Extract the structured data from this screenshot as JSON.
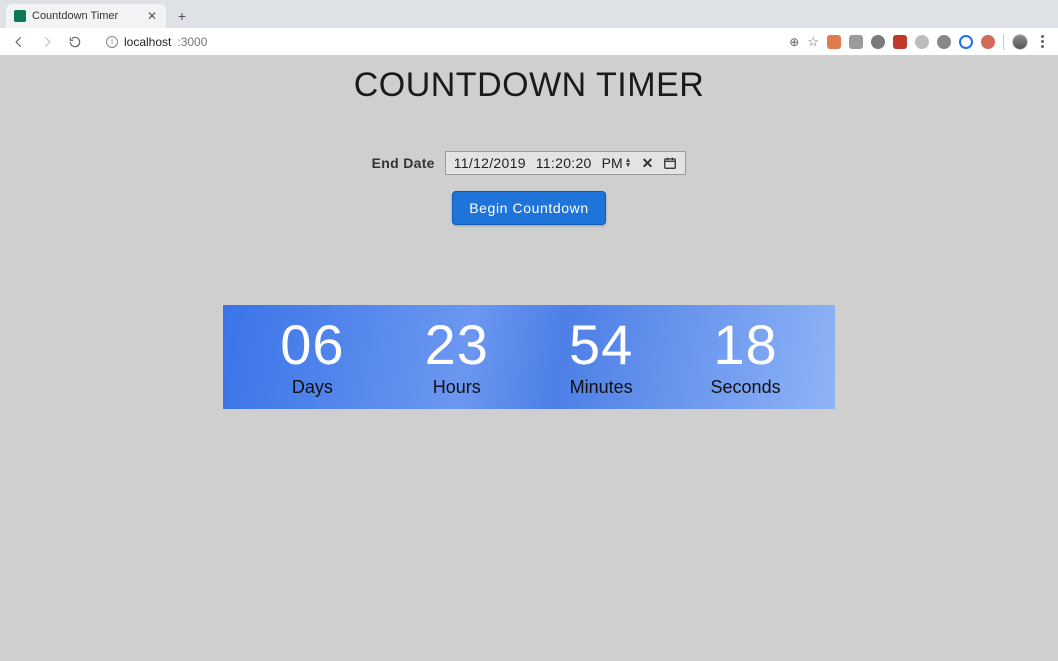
{
  "browser": {
    "tab_title": "Countdown Timer",
    "url_host": "localhost",
    "url_port": ":3000"
  },
  "page": {
    "heading": "COUNTDOWN TIMER",
    "form": {
      "end_date_label": "End Date",
      "date_value": "11/12/2019",
      "time_value": "11:20:20",
      "ampm": "PM",
      "begin_button": "Begin Countdown"
    },
    "countdown": {
      "days": {
        "value": "06",
        "label": "Days"
      },
      "hours": {
        "value": "23",
        "label": "Hours"
      },
      "minutes": {
        "value": "54",
        "label": "Minutes"
      },
      "seconds": {
        "value": "18",
        "label": "Seconds"
      }
    }
  }
}
